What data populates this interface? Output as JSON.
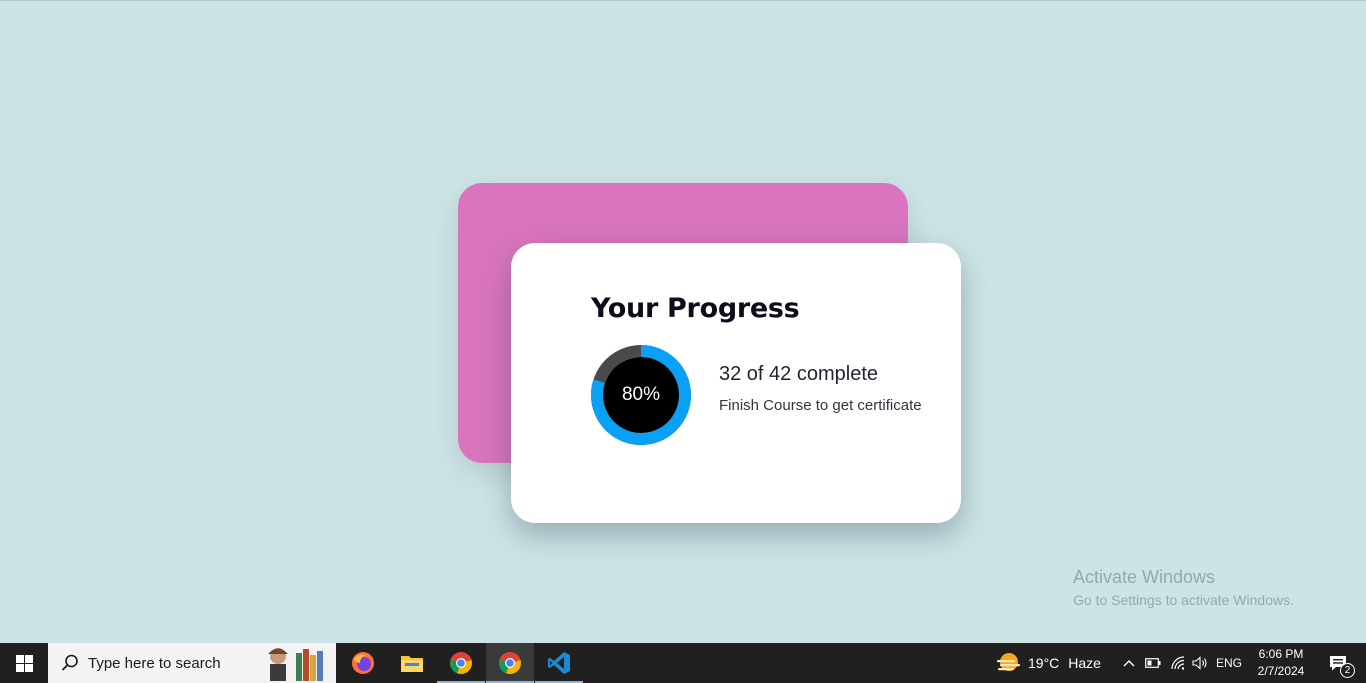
{
  "progress_card": {
    "title": "Your Progress",
    "percent_label": "80%",
    "percent_value": 80,
    "completed": 32,
    "total": 42,
    "count_text": "32 of 42 complete",
    "subtitle": "Finish Course to get certificate",
    "colors": {
      "back_card": "#da74bf",
      "ring_fill": "#0aa0f5",
      "ring_track": "#4a4a4a",
      "ring_center": "#000000"
    }
  },
  "watermark": {
    "line1": "Activate Windows",
    "line2": "Go to Settings to activate Windows."
  },
  "taskbar": {
    "search_placeholder": "Type here to search",
    "apps": [
      "firefox-icon",
      "file-explorer-icon",
      "chrome-icon",
      "chrome-icon",
      "vscode-icon"
    ],
    "weather": {
      "temp": "19°C",
      "condition": "Haze"
    },
    "language": "ENG",
    "time": "6:06 PM",
    "date": "2/7/2024",
    "notification_count": "2"
  }
}
